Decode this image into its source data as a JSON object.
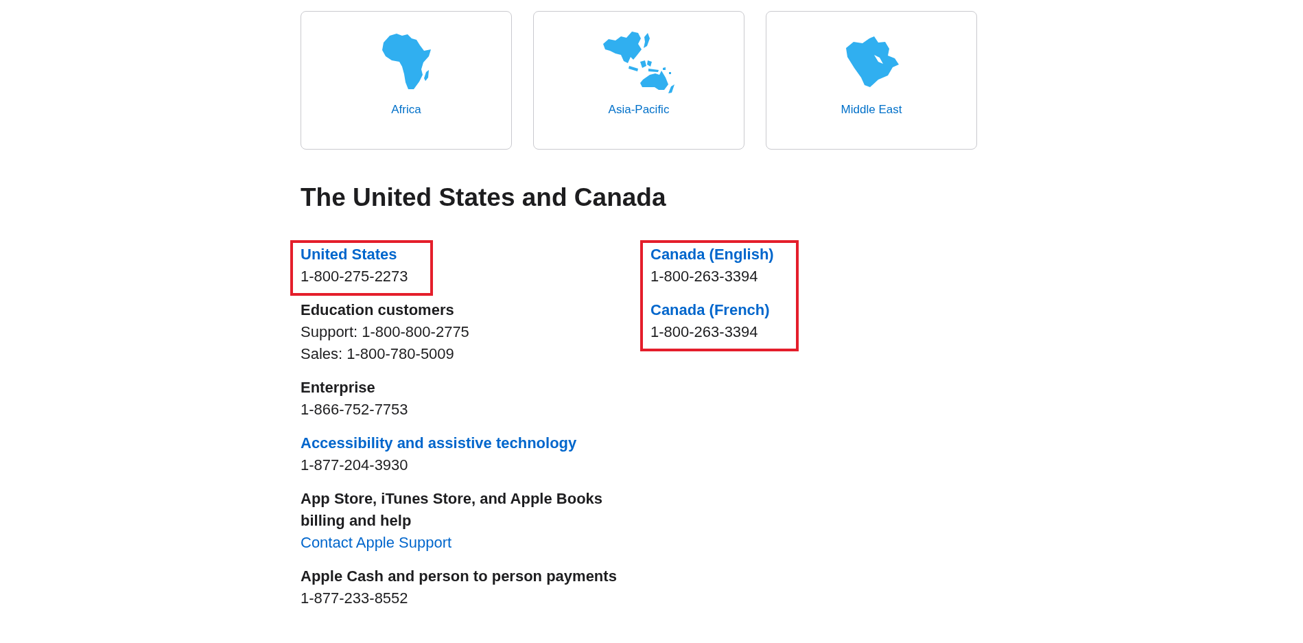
{
  "region_cards": [
    {
      "label": "Africa"
    },
    {
      "label": "Asia-Pacific"
    },
    {
      "label": "Middle East"
    }
  ],
  "section": {
    "title": "The United States and Canada",
    "columns": [
      {
        "blocks": [
          {
            "highlighted": true,
            "entries": [
              {
                "title": {
                  "kind": "link",
                  "text": "United States"
                },
                "lines": [
                  {
                    "kind": "text",
                    "text": "1-800-275-2273"
                  }
                ]
              }
            ]
          },
          {
            "highlighted": false,
            "entries": [
              {
                "title": {
                  "kind": "label",
                  "text": "Education customers"
                },
                "lines": [
                  {
                    "kind": "text",
                    "text": "Support: 1-800-800-2775"
                  },
                  {
                    "kind": "text",
                    "text": "Sales: 1-800-780-5009"
                  }
                ]
              },
              {
                "title": {
                  "kind": "label",
                  "text": "Enterprise"
                },
                "lines": [
                  {
                    "kind": "text",
                    "text": "1-866-752-7753"
                  }
                ]
              },
              {
                "title": {
                  "kind": "link",
                  "text": "Accessibility and assistive technology"
                },
                "lines": [
                  {
                    "kind": "text",
                    "text": "1-877-204-3930"
                  }
                ]
              },
              {
                "title": {
                  "kind": "label",
                  "text": "App Store, iTunes Store, and Apple Books billing and help"
                },
                "lines": [
                  {
                    "kind": "link",
                    "text": "Contact Apple Support"
                  }
                ]
              },
              {
                "title": {
                  "kind": "label",
                  "text": "Apple Cash and person to person payments"
                },
                "lines": [
                  {
                    "kind": "text",
                    "text": "1-877-233-8552"
                  }
                ]
              }
            ]
          }
        ]
      },
      {
        "blocks": [
          {
            "highlighted": true,
            "entries": [
              {
                "title": {
                  "kind": "link",
                  "text": "Canada (English)"
                },
                "lines": [
                  {
                    "kind": "text",
                    "text": "1-800-263-3394"
                  }
                ]
              },
              {
                "title": {
                  "kind": "link",
                  "text": "Canada (French)"
                },
                "lines": [
                  {
                    "kind": "text",
                    "text": "1-800-263-3394"
                  }
                ]
              }
            ]
          }
        ]
      }
    ]
  }
}
